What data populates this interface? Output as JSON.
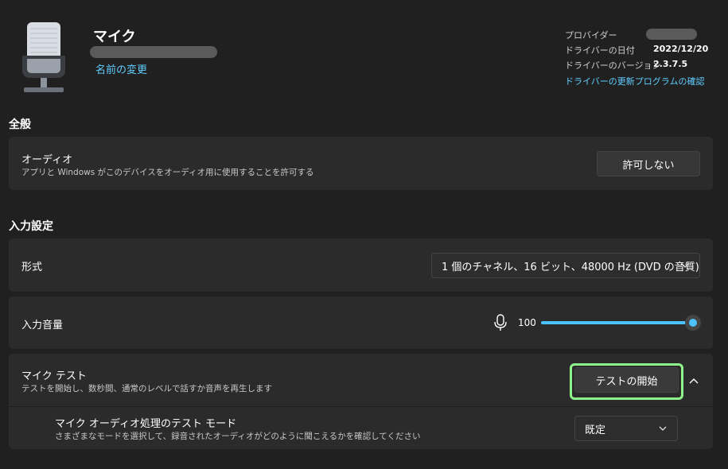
{
  "device": {
    "name": "マイク",
    "rename_link": "名前の変更",
    "icon": "microphone-hero-icon"
  },
  "driver_info": {
    "provider_label": "プロバイダー",
    "date_label": "ドライバーの日付",
    "date_value": "2022/12/20",
    "version_label": "ドライバーのバージョン",
    "version_value": "2.3.7.5",
    "update_link": "ドライバーの更新プログラムの確認"
  },
  "general": {
    "title": "全般",
    "audio": {
      "title": "オーディオ",
      "description": "アプリと Windows がこのデバイスをオーディオ用に使用することを許可する",
      "button": "許可しない"
    }
  },
  "input_settings": {
    "title": "入力設定",
    "format": {
      "label": "形式",
      "value": "1 個のチャネル、16 ビット、48000 Hz (DVD の音質)"
    },
    "volume": {
      "label": "入力音量",
      "value": "100",
      "level": 1.0,
      "icon": "microphone-icon"
    },
    "mic_test": {
      "title": "マイク テスト",
      "description": "テストを開始し、数秒間、通常のレベルで話すか音声を再生します",
      "button": "テストの開始",
      "toggle_icon": "chevron-up-icon"
    },
    "test_mode": {
      "title": "マイク オーディオ処理のテスト モード",
      "description": "さまざまなモードを選択して、録音されたオーディオがどのように聞こえるかを確認してください",
      "value": "既定"
    }
  },
  "colors": {
    "accent": "#60cdff",
    "slider": "#4cc2ff",
    "highlight": "#8ff58a",
    "card": "#2b2b2b",
    "background": "#202020"
  }
}
